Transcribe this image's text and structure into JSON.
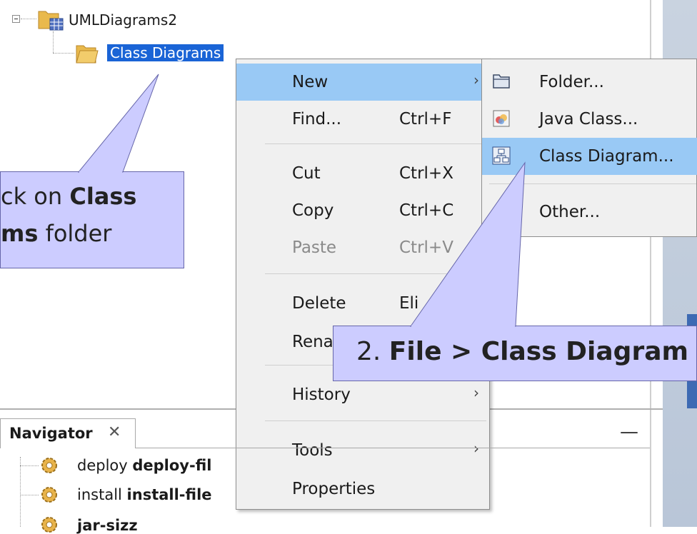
{
  "tree": {
    "project": {
      "label": "UMLDiagrams2"
    },
    "folder": {
      "label": "Class Diagrams"
    }
  },
  "callout1": {
    "line1_prefix": "ck on ",
    "line1_bold": "Class",
    "line2_bold": "ms",
    "line2_suffix": " folder"
  },
  "callout2": {
    "prefix": "2. ",
    "bold": "File > Class Diagram"
  },
  "context_menu": {
    "new": {
      "label": "New",
      "arrow": "›"
    },
    "find": {
      "label": "Find...",
      "shortcut": "Ctrl+F"
    },
    "cut": {
      "label": "Cut",
      "shortcut": "Ctrl+X"
    },
    "copy": {
      "label": "Copy",
      "shortcut": "Ctrl+C"
    },
    "paste": {
      "label": "Paste",
      "shortcut": "Ctrl+V"
    },
    "delete": {
      "label": "Delete",
      "shortcut": "Eli"
    },
    "rename": {
      "label": "Rena"
    },
    "history": {
      "label": "History",
      "arrow": "›"
    },
    "tools": {
      "label": "Tools",
      "arrow": "›"
    },
    "properties": {
      "label": "Properties"
    }
  },
  "submenu": {
    "folder": {
      "label": "Folder...",
      "icon": "folder-icon"
    },
    "java_class": {
      "label": "Java Class...",
      "icon": "java-class-icon"
    },
    "class_diagram": {
      "label": "Class Diagram...",
      "icon": "class-diagram-icon"
    },
    "other": {
      "label": "Other..."
    }
  },
  "navigator": {
    "title": "Navigator",
    "close": "✕",
    "minimize": "—",
    "items": [
      {
        "prefix": "deploy ",
        "bold": "deploy-fil"
      },
      {
        "prefix": "install ",
        "bold": "install-file"
      },
      {
        "prefix": "",
        "bold": "jar-sizz"
      }
    ]
  },
  "colors": {
    "selection": "#1a64d6",
    "menu_highlight": "#99c9f5",
    "callout_fill": "#ccccff",
    "menu_bg": "#f0f0f0"
  }
}
